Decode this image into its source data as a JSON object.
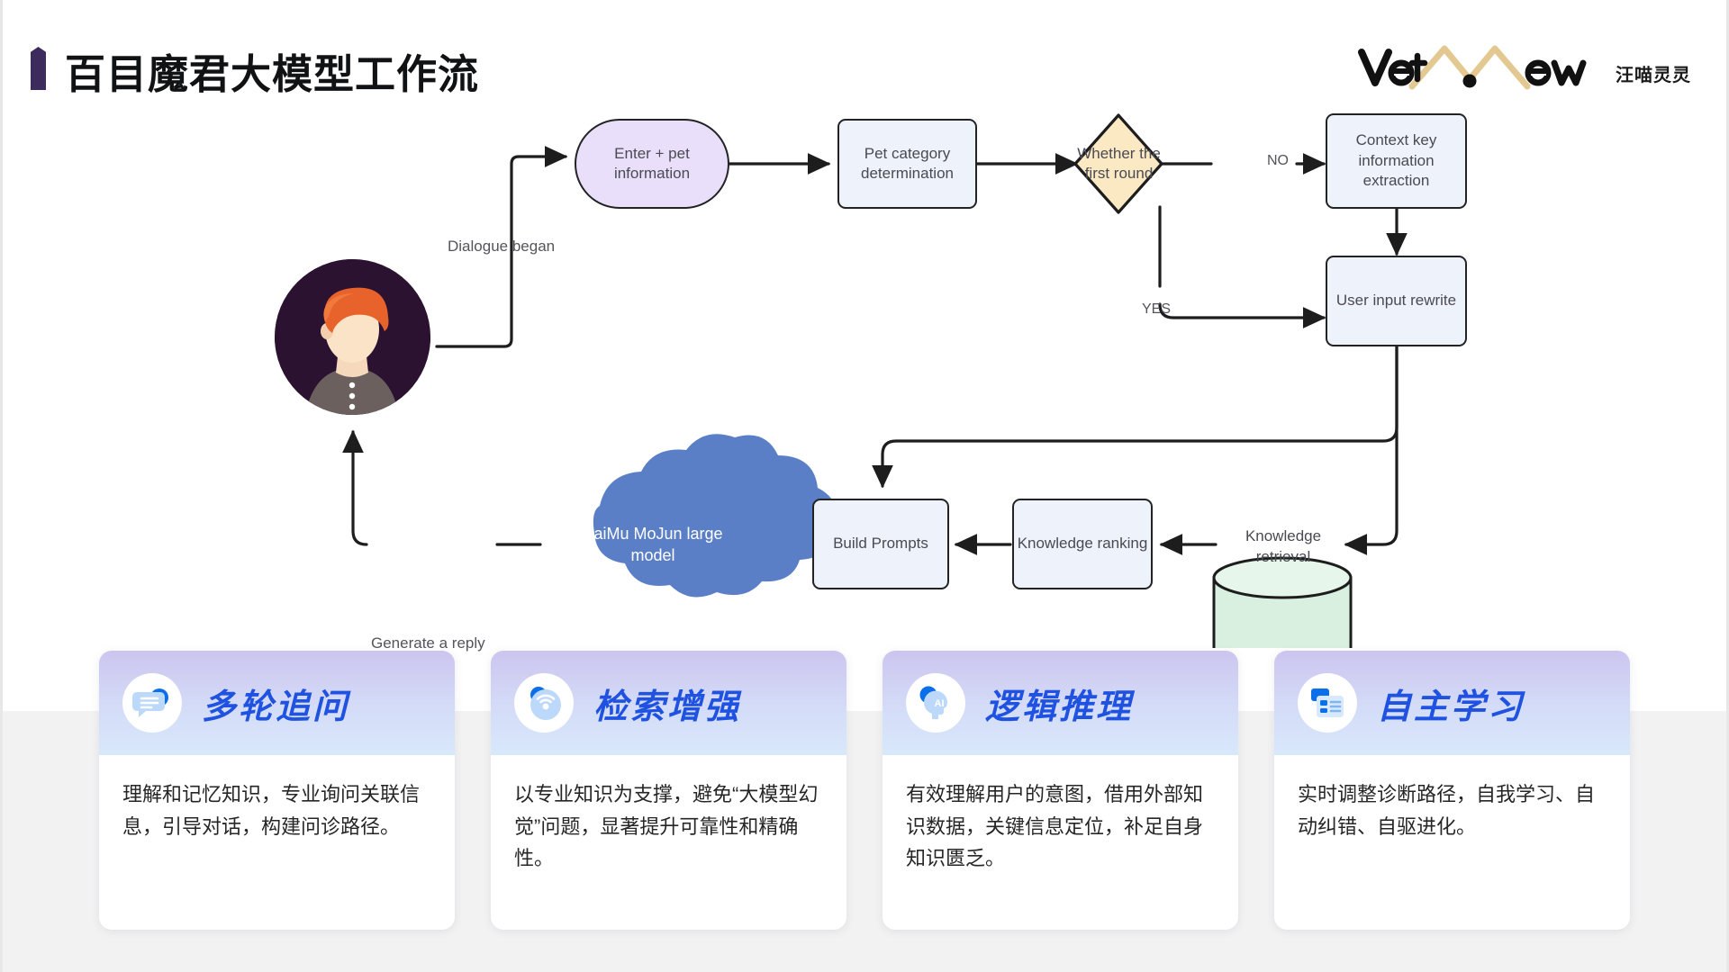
{
  "header": {
    "title": "百目魔君大模型工作流",
    "accent_color": "#3D2B5E",
    "logo": {
      "text_left": "Vet",
      "text_right": "ew",
      "mountain_color": "#E3C892",
      "wordmark_color": "#111111",
      "cn_text": "汪喵灵灵"
    }
  },
  "flow": {
    "nodes": {
      "enter_pet_info": "Enter + pet information",
      "pet_category": "Pet category determination",
      "whether_first_round": "Whether the first round",
      "context_key_extraction": "Context key information extraction",
      "user_input_rewrite": "User input rewrite",
      "knowledge_retrieval": "Knowledge retrieval",
      "knowledge_ranking": "Knowledge ranking",
      "build_prompts": "Build Prompts",
      "large_model": "BaiMu MoJun large model"
    },
    "edge_labels": {
      "dialogue_began": "Dialogue began",
      "no": "NO",
      "yes": "YES",
      "generate_reply": "Generate a reply"
    },
    "colors": {
      "rect_fill": "#eef2fb",
      "pill_fill": "#eadffa",
      "diamond_fill": "#fbe9c4",
      "cylinder_fill": "#d9f0e0",
      "cloud_fill": "#5b7fc7",
      "stroke": "#232323"
    }
  },
  "cards": [
    {
      "icon": "chat-bubble-icon",
      "title": "多轮追问",
      "body": "理解和记忆知识，专业询问关联信息，引导对话，构建问诊路径。"
    },
    {
      "icon": "radar-signal-icon",
      "title": "检索增强",
      "body": "以专业知识为支撑，避免“大模型幻觉”问题，显著提升可靠性和精确性。"
    },
    {
      "icon": "ai-head-icon",
      "title": "逻辑推理",
      "body": "有效理解用户的意图，借用外部知识数据，关键信息定位，补足自身知识匮乏。"
    },
    {
      "icon": "document-list-icon",
      "title": "自主学习",
      "body": "实时调整诊断路径，自我学习、自动纠错、自驱进化。"
    }
  ]
}
